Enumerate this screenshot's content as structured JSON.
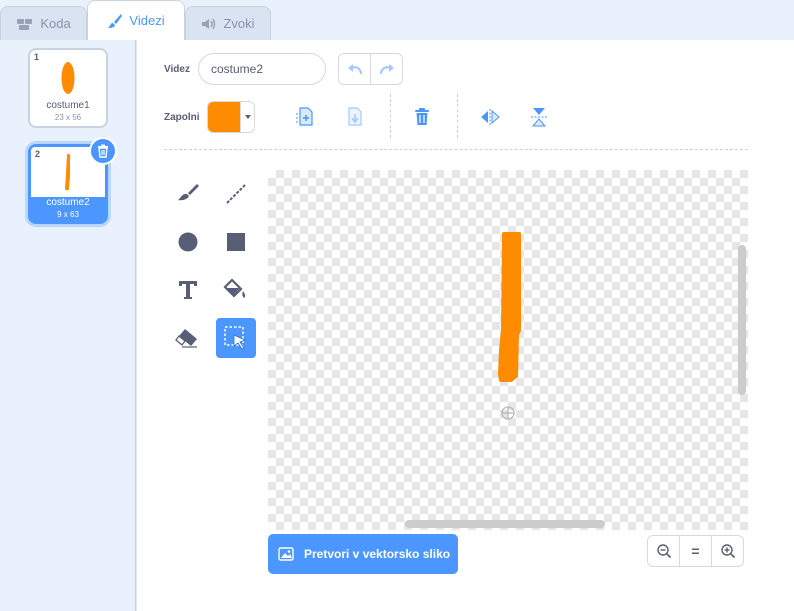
{
  "tabs": [
    {
      "label": "Koda",
      "icon": "code-icon"
    },
    {
      "label": "Videzi",
      "icon": "paintbrush-icon"
    },
    {
      "label": "Zvoki",
      "icon": "speaker-icon"
    }
  ],
  "costumes": [
    {
      "number": "1",
      "name": "costume1",
      "size": "23 x 56",
      "selected": false
    },
    {
      "number": "2",
      "name": "costume2",
      "size": "9 x 63",
      "selected": true
    }
  ],
  "editor": {
    "costume_label": "Videz",
    "costume_name": "costume2",
    "fill_label": "Zapolni",
    "fill_color": "#ff8c00",
    "convert_button": "Pretvori v vektorsko sliko",
    "zoom_reset": "="
  },
  "colors": {
    "accent": "#4c97ff",
    "paint": "#ff8c00",
    "text": "#575e75"
  }
}
